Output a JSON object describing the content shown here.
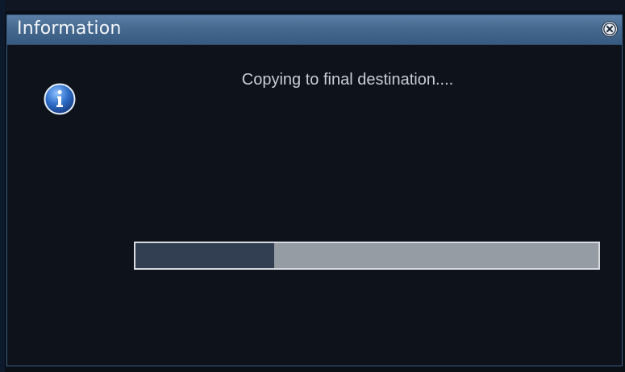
{
  "dialog": {
    "title": "Information",
    "message": "Copying to final destination....",
    "progress_fraction": 0.3
  },
  "icons": {
    "status": "info-icon",
    "close": "close-icon"
  },
  "colors": {
    "titlebar": "#46698f",
    "dialog_bg": "#0d121b",
    "progress_track": "#969ca3",
    "progress_fill": "#323e51",
    "info_icon_blue": "#2f6fc9"
  }
}
